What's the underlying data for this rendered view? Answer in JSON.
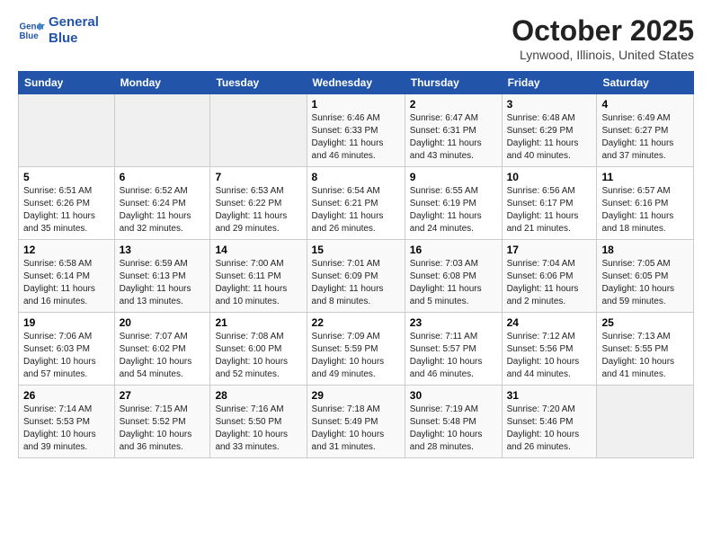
{
  "header": {
    "logo_line1": "General",
    "logo_line2": "Blue",
    "month": "October 2025",
    "location": "Lynwood, Illinois, United States"
  },
  "days_of_week": [
    "Sunday",
    "Monday",
    "Tuesday",
    "Wednesday",
    "Thursday",
    "Friday",
    "Saturday"
  ],
  "weeks": [
    [
      {
        "num": "",
        "info": ""
      },
      {
        "num": "",
        "info": ""
      },
      {
        "num": "",
        "info": ""
      },
      {
        "num": "1",
        "info": "Sunrise: 6:46 AM\nSunset: 6:33 PM\nDaylight: 11 hours and 46 minutes."
      },
      {
        "num": "2",
        "info": "Sunrise: 6:47 AM\nSunset: 6:31 PM\nDaylight: 11 hours and 43 minutes."
      },
      {
        "num": "3",
        "info": "Sunrise: 6:48 AM\nSunset: 6:29 PM\nDaylight: 11 hours and 40 minutes."
      },
      {
        "num": "4",
        "info": "Sunrise: 6:49 AM\nSunset: 6:27 PM\nDaylight: 11 hours and 37 minutes."
      }
    ],
    [
      {
        "num": "5",
        "info": "Sunrise: 6:51 AM\nSunset: 6:26 PM\nDaylight: 11 hours and 35 minutes."
      },
      {
        "num": "6",
        "info": "Sunrise: 6:52 AM\nSunset: 6:24 PM\nDaylight: 11 hours and 32 minutes."
      },
      {
        "num": "7",
        "info": "Sunrise: 6:53 AM\nSunset: 6:22 PM\nDaylight: 11 hours and 29 minutes."
      },
      {
        "num": "8",
        "info": "Sunrise: 6:54 AM\nSunset: 6:21 PM\nDaylight: 11 hours and 26 minutes."
      },
      {
        "num": "9",
        "info": "Sunrise: 6:55 AM\nSunset: 6:19 PM\nDaylight: 11 hours and 24 minutes."
      },
      {
        "num": "10",
        "info": "Sunrise: 6:56 AM\nSunset: 6:17 PM\nDaylight: 11 hours and 21 minutes."
      },
      {
        "num": "11",
        "info": "Sunrise: 6:57 AM\nSunset: 6:16 PM\nDaylight: 11 hours and 18 minutes."
      }
    ],
    [
      {
        "num": "12",
        "info": "Sunrise: 6:58 AM\nSunset: 6:14 PM\nDaylight: 11 hours and 16 minutes."
      },
      {
        "num": "13",
        "info": "Sunrise: 6:59 AM\nSunset: 6:13 PM\nDaylight: 11 hours and 13 minutes."
      },
      {
        "num": "14",
        "info": "Sunrise: 7:00 AM\nSunset: 6:11 PM\nDaylight: 11 hours and 10 minutes."
      },
      {
        "num": "15",
        "info": "Sunrise: 7:01 AM\nSunset: 6:09 PM\nDaylight: 11 hours and 8 minutes."
      },
      {
        "num": "16",
        "info": "Sunrise: 7:03 AM\nSunset: 6:08 PM\nDaylight: 11 hours and 5 minutes."
      },
      {
        "num": "17",
        "info": "Sunrise: 7:04 AM\nSunset: 6:06 PM\nDaylight: 11 hours and 2 minutes."
      },
      {
        "num": "18",
        "info": "Sunrise: 7:05 AM\nSunset: 6:05 PM\nDaylight: 10 hours and 59 minutes."
      }
    ],
    [
      {
        "num": "19",
        "info": "Sunrise: 7:06 AM\nSunset: 6:03 PM\nDaylight: 10 hours and 57 minutes."
      },
      {
        "num": "20",
        "info": "Sunrise: 7:07 AM\nSunset: 6:02 PM\nDaylight: 10 hours and 54 minutes."
      },
      {
        "num": "21",
        "info": "Sunrise: 7:08 AM\nSunset: 6:00 PM\nDaylight: 10 hours and 52 minutes."
      },
      {
        "num": "22",
        "info": "Sunrise: 7:09 AM\nSunset: 5:59 PM\nDaylight: 10 hours and 49 minutes."
      },
      {
        "num": "23",
        "info": "Sunrise: 7:11 AM\nSunset: 5:57 PM\nDaylight: 10 hours and 46 minutes."
      },
      {
        "num": "24",
        "info": "Sunrise: 7:12 AM\nSunset: 5:56 PM\nDaylight: 10 hours and 44 minutes."
      },
      {
        "num": "25",
        "info": "Sunrise: 7:13 AM\nSunset: 5:55 PM\nDaylight: 10 hours and 41 minutes."
      }
    ],
    [
      {
        "num": "26",
        "info": "Sunrise: 7:14 AM\nSunset: 5:53 PM\nDaylight: 10 hours and 39 minutes."
      },
      {
        "num": "27",
        "info": "Sunrise: 7:15 AM\nSunset: 5:52 PM\nDaylight: 10 hours and 36 minutes."
      },
      {
        "num": "28",
        "info": "Sunrise: 7:16 AM\nSunset: 5:50 PM\nDaylight: 10 hours and 33 minutes."
      },
      {
        "num": "29",
        "info": "Sunrise: 7:18 AM\nSunset: 5:49 PM\nDaylight: 10 hours and 31 minutes."
      },
      {
        "num": "30",
        "info": "Sunrise: 7:19 AM\nSunset: 5:48 PM\nDaylight: 10 hours and 28 minutes."
      },
      {
        "num": "31",
        "info": "Sunrise: 7:20 AM\nSunset: 5:46 PM\nDaylight: 10 hours and 26 minutes."
      },
      {
        "num": "",
        "info": ""
      }
    ]
  ]
}
